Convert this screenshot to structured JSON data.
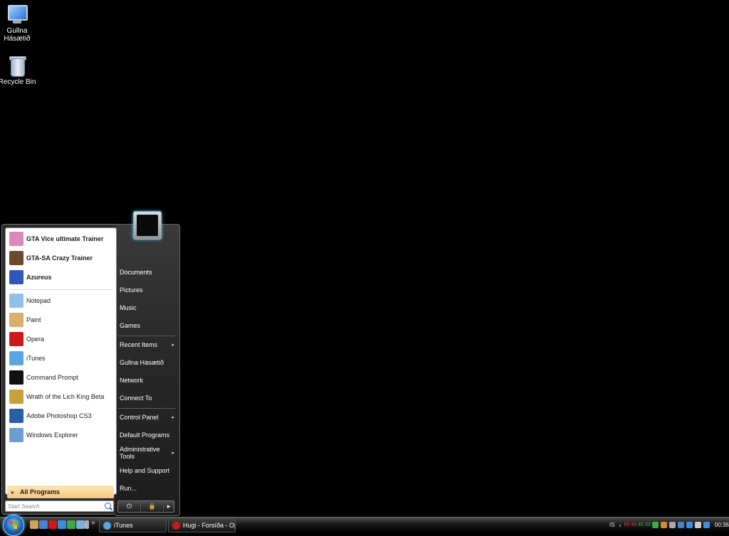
{
  "desktop": {
    "icons": [
      {
        "label_line1": "Gullna",
        "label_line2": "Hásætið",
        "icon": "computer-icon"
      },
      {
        "label_line1": "Recycle Bin",
        "label_line2": "",
        "icon": "recycle-bin-icon"
      }
    ]
  },
  "start_menu": {
    "pinned": [
      {
        "label": "GTA Vice ultimate Trainer",
        "icon": "gta-vice-icon",
        "color": "#d98ab8"
      },
      {
        "label": "GTA-SA Crazy Trainer",
        "icon": "gta-sa-icon",
        "color": "#6b4a2c"
      },
      {
        "label": "Azureus",
        "icon": "azureus-frog-icon",
        "color": "#2f58b8"
      }
    ],
    "recent": [
      {
        "label": "Notepad",
        "icon": "notepad-icon",
        "color": "#8fc3e6"
      },
      {
        "label": "Paint",
        "icon": "paint-icon",
        "color": "#d8b06a"
      },
      {
        "label": "Opera",
        "icon": "opera-icon",
        "color": "#cc1a1a"
      },
      {
        "label": "iTunes",
        "icon": "itunes-icon",
        "color": "#5aa6e0"
      },
      {
        "label": "Command Prompt",
        "icon": "command-prompt-icon",
        "color": "#111111"
      },
      {
        "label": "Wrath of the Lich King Beta",
        "icon": "wow-icon",
        "color": "#c7a23a"
      },
      {
        "label": "Adobe Photoshop CS3",
        "icon": "photoshop-icon",
        "color": "#2a5ea8"
      },
      {
        "label": "Windows Explorer",
        "icon": "windows-explorer-icon",
        "color": "#6e9ed0"
      }
    ],
    "all_programs": "All Programs",
    "search_placeholder": "Start Search",
    "right_items": [
      {
        "label": "Documents",
        "has_submenu": false
      },
      {
        "label": "Pictures",
        "has_submenu": false
      },
      {
        "label": "Music",
        "has_submenu": false
      },
      {
        "label": "Games",
        "has_submenu": false
      },
      {
        "label": "Recent Items",
        "has_submenu": true
      },
      {
        "label": "Gullna Hásætið",
        "has_submenu": false
      },
      {
        "label": "Network",
        "has_submenu": false
      },
      {
        "label": "Connect To",
        "has_submenu": false
      },
      {
        "label": "Control Panel",
        "has_submenu": true
      },
      {
        "label": "Default Programs",
        "has_submenu": false
      },
      {
        "label": "Administrative Tools",
        "has_submenu": true
      },
      {
        "label": "Help and Support",
        "has_submenu": false
      },
      {
        "label": "Run...",
        "has_submenu": false
      }
    ],
    "submenu_arrow": "▸",
    "power_glyph": "⏻",
    "lock_glyph": "🔒",
    "more_glyph": "▸"
  },
  "taskbar": {
    "quick_launch": [
      {
        "icon": "show-desktop-icon",
        "color": "#c9a45a"
      },
      {
        "icon": "switch-windows-icon",
        "color": "#4b7fd1"
      },
      {
        "icon": "opera-icon",
        "color": "#cc1a1a"
      },
      {
        "icon": "ie-icon",
        "color": "#3a8ee0"
      },
      {
        "icon": "messenger-icon",
        "color": "#3fa84a"
      },
      {
        "icon": "notepad-icon",
        "color": "#7fb0d8"
      },
      {
        "icon": "ql-app-icon",
        "color": "#b0b0b0"
      }
    ],
    "quick_launch_more": "»",
    "tasks": [
      {
        "label": "iTunes",
        "icon": "itunes-icon",
        "color": "#5aa6e0"
      },
      {
        "label": "Hugi - Forsíða - Op...",
        "icon": "opera-icon",
        "color": "#cc1a1a"
      }
    ],
    "tray": {
      "language": "IS",
      "expand": "‹",
      "numbers": [
        {
          "value": "85",
          "color": "#e33"
        },
        {
          "value": "48",
          "color": "#e33"
        },
        {
          "value": "45",
          "color": "#3c3"
        },
        {
          "value": "53",
          "color": "#3c3"
        }
      ],
      "icons": [
        {
          "icon": "network-icon",
          "color": "#3fa84a"
        },
        {
          "icon": "fire-icon",
          "color": "#d28a2a"
        },
        {
          "icon": "w-icon",
          "color": "#aaaaaa"
        },
        {
          "icon": "connection-icon",
          "color": "#4b7fd1"
        },
        {
          "icon": "security-icon",
          "color": "#3a8ee0"
        },
        {
          "icon": "volume-icon",
          "color": "#cccccc"
        },
        {
          "icon": "display-icon",
          "color": "#3a8ee0"
        }
      ],
      "clock": "00:36"
    }
  }
}
